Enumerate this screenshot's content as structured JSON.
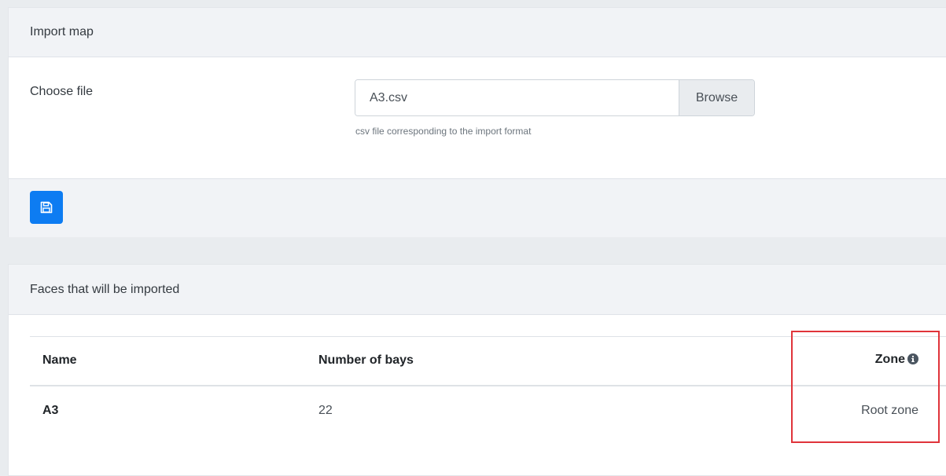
{
  "import_card": {
    "title": "Import map",
    "choose_file_label": "Choose file",
    "file_value": "A3.csv",
    "browse_label": "Browse",
    "help_text": "csv file corresponding to the import format",
    "save_icon": "floppy-disk-icon"
  },
  "faces_card": {
    "title": "Faces that will be imported",
    "columns": [
      "Name",
      "Number of bays",
      "Zone"
    ],
    "zone_info_icon": "info-circle-icon",
    "rows": [
      {
        "name": "A3",
        "bays": "22",
        "zone": "Root zone"
      }
    ]
  },
  "colors": {
    "primary": "#0d7cf2",
    "highlight": "#e0343a",
    "header_bg": "#f1f3f6",
    "page_bg": "#e9ecef"
  }
}
